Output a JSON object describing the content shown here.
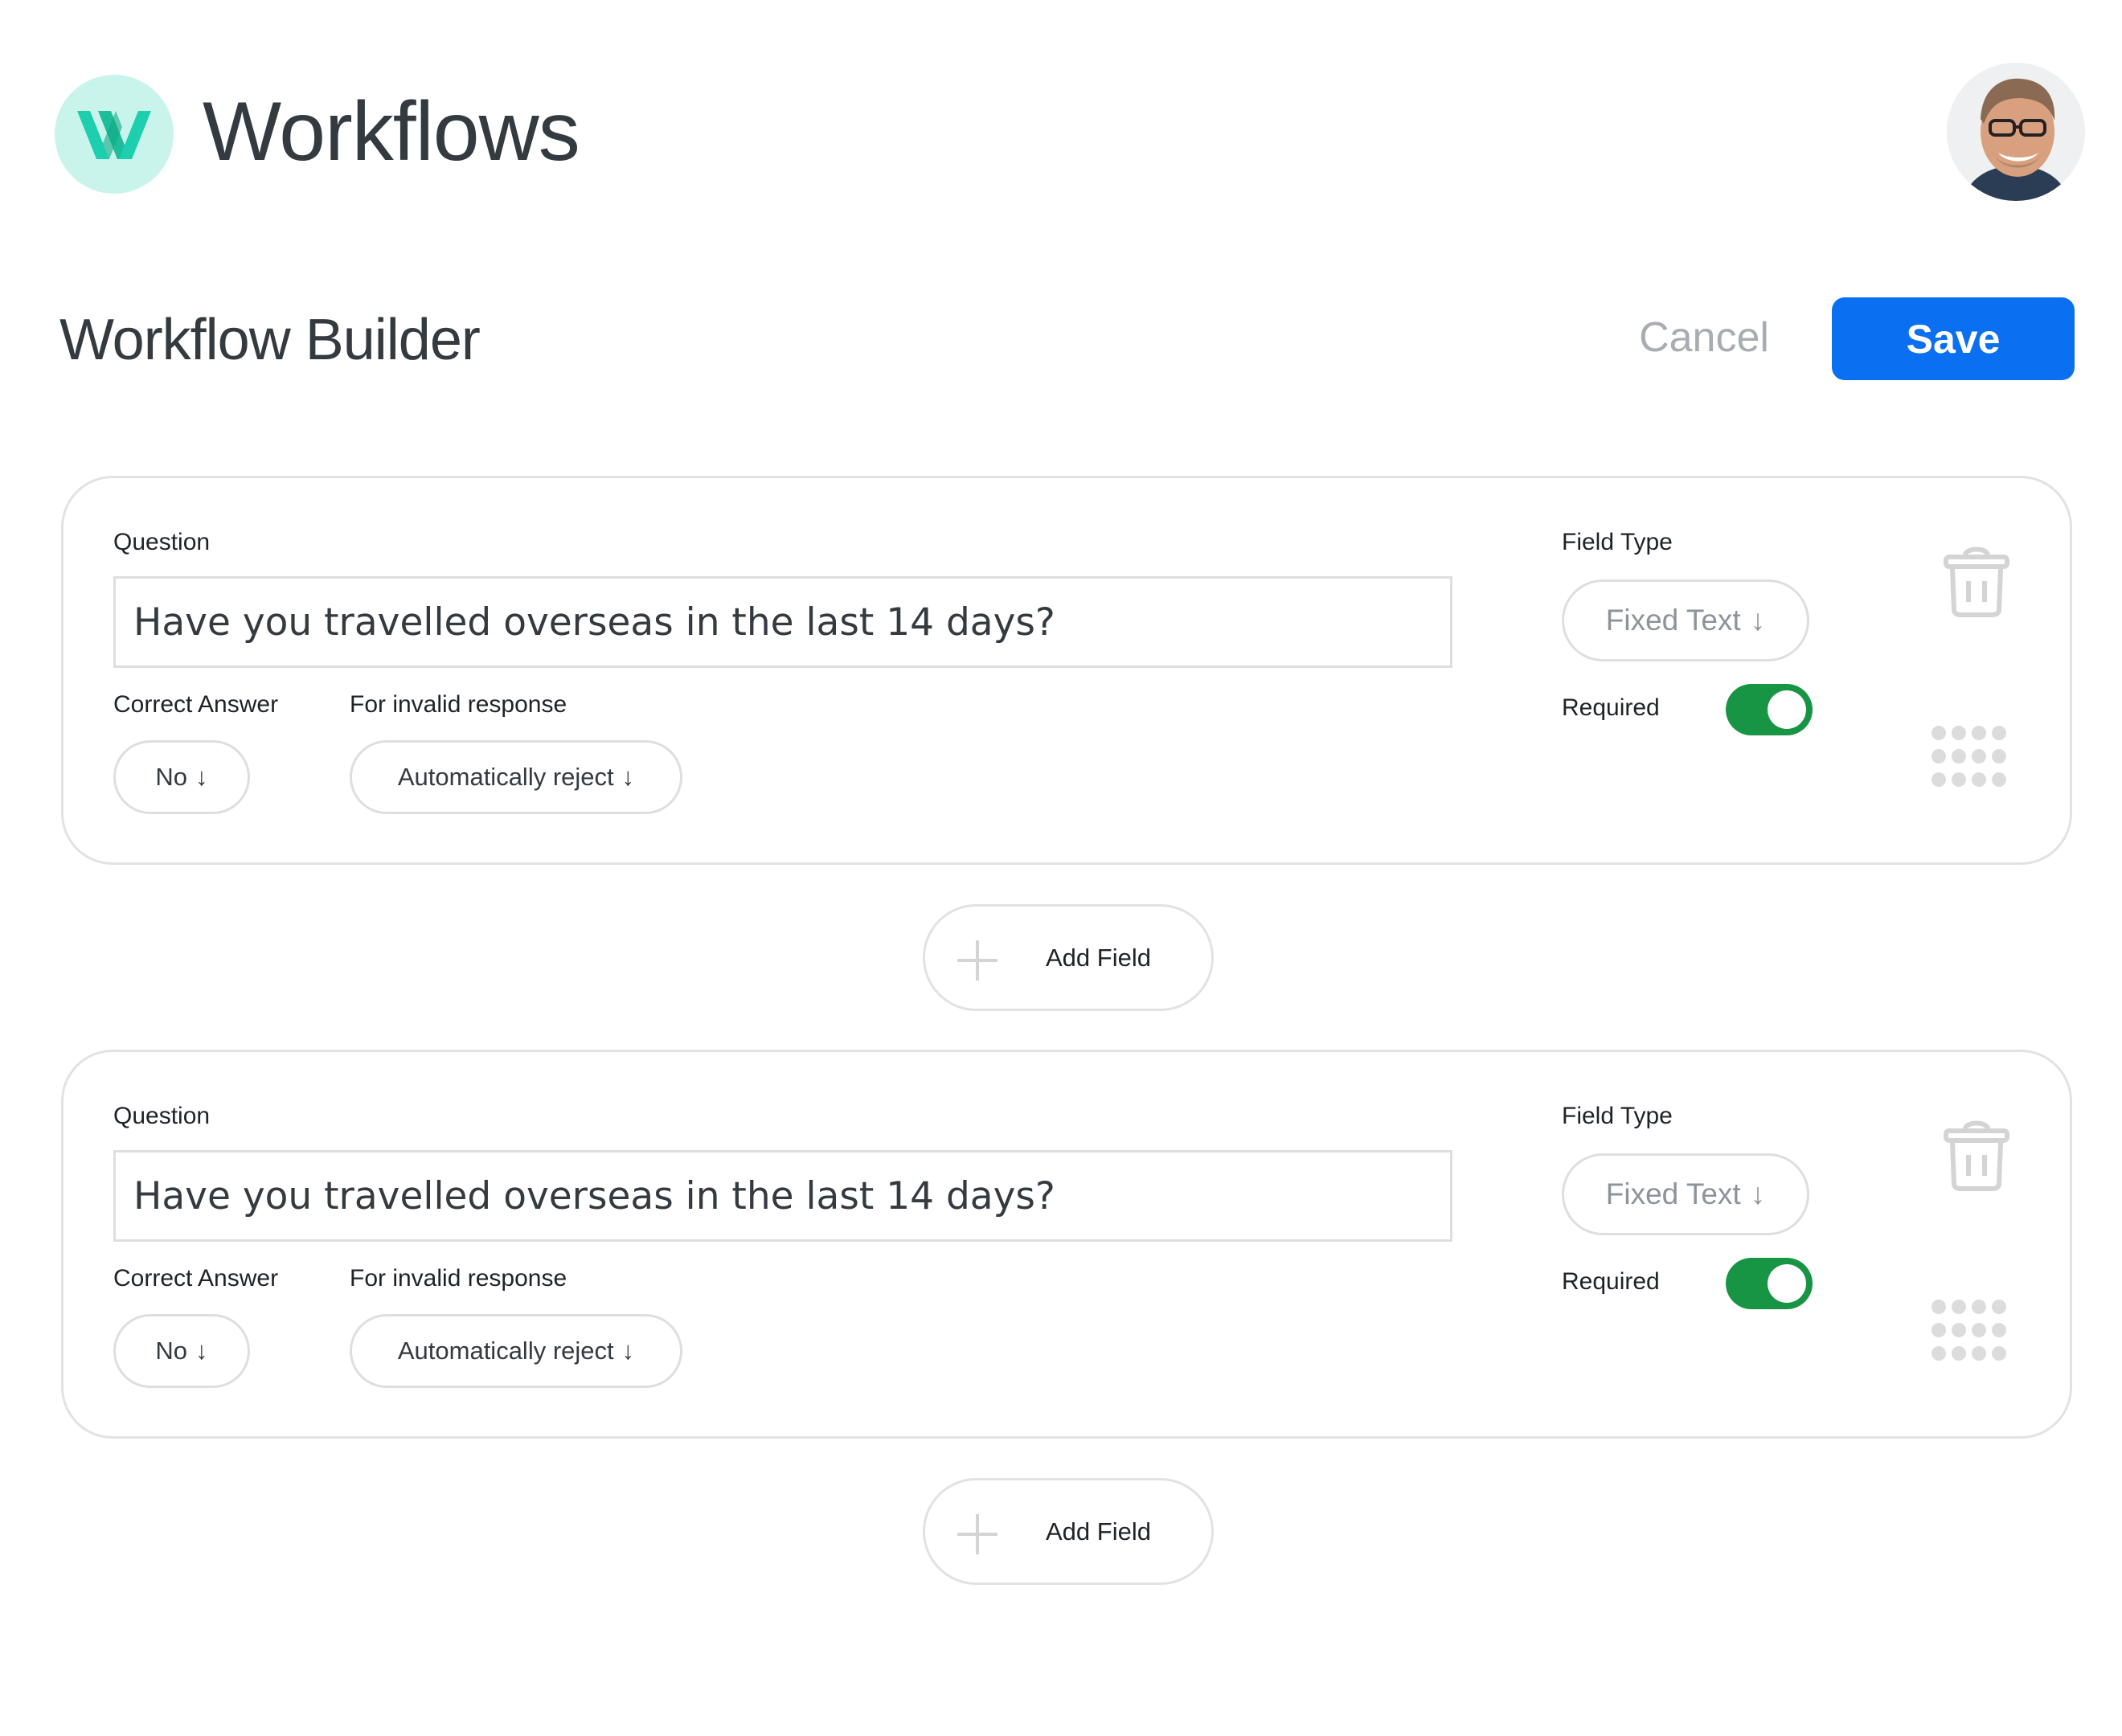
{
  "header": {
    "app_title": "Workflows",
    "logo_icon": "w-logo-icon",
    "brand_color": "#1dcfae",
    "avatar_icon": "user-avatar"
  },
  "builder": {
    "title": "Workflow Builder",
    "cancel_label": "Cancel",
    "save_label": "Save",
    "accent_color": "#0a6ff0"
  },
  "fields": [
    {
      "question_label": "Question",
      "question_value": "Have you travelled overseas in the last 14 days?",
      "correct_answer_label": "Correct Answer",
      "correct_answer_value": "No",
      "invalid_label": "For invalid response",
      "invalid_value": "Automatically reject",
      "field_type_label": "Field Type",
      "field_type_value": "Fixed Text",
      "required_label": "Required",
      "required": true
    },
    {
      "question_label": "Question",
      "question_value": "Have you travelled overseas in the last 14 days?",
      "correct_answer_label": "Correct Answer",
      "correct_answer_value": "No",
      "invalid_label": "For invalid response",
      "invalid_value": "Automatically reject",
      "field_type_label": "Field Type",
      "field_type_value": "Fixed Text",
      "required_label": "Required",
      "required": true
    }
  ],
  "add_field": {
    "label": "Add Field",
    "icon": "plus-icon"
  },
  "icons": {
    "dropdown_arrow": "↓",
    "trash": "trash-icon",
    "drag": "drag-handle-icon"
  },
  "toggle_on_color": "#179544"
}
